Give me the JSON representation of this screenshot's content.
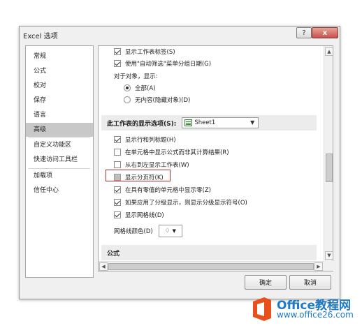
{
  "window": {
    "title": "Excel 选项",
    "help_label": "?",
    "close_label": "x"
  },
  "sidebar": {
    "items": [
      {
        "label": "常规"
      },
      {
        "label": "公式"
      },
      {
        "label": "校对"
      },
      {
        "label": "保存"
      },
      {
        "label": "语言"
      },
      {
        "label": "高级",
        "active": true
      },
      {
        "label": "自定义功能区"
      },
      {
        "label": "快速访问工具栏"
      },
      {
        "label": "加载项"
      },
      {
        "label": "信任中心"
      }
    ]
  },
  "options": {
    "show_sheet_tabs": {
      "label": "显示工作表标签(S)",
      "checked": true
    },
    "group_dates": {
      "label": "使用\"自动筛选\"菜单分组日期(G)",
      "checked": true
    },
    "objects_label": "对于对象，显示:",
    "radio_all": {
      "label": "全部(A)",
      "selected": true
    },
    "radio_none": {
      "label": "无内容(隐藏对象)(D)",
      "selected": false
    }
  },
  "sheet_section": {
    "title": "此工作表的显示选项(S):",
    "selected_sheet": "Sheet1",
    "items": [
      {
        "label": "显示行和列标题(H)",
        "checked": true
      },
      {
        "label": "在单元格中显示公式而非其计算结果(R)",
        "checked": false
      },
      {
        "label": "从右到左显示工作表(W)",
        "checked": false
      },
      {
        "label": "显示分页符(K)",
        "checked": false
      },
      {
        "label": "在具有零值的单元格中显示零(Z)",
        "checked": true
      },
      {
        "label": "如果应用了分级显示，则显示分级显示符号(O)",
        "checked": true
      },
      {
        "label": "显示网格线(D)",
        "checked": true
      }
    ],
    "gridline_color_label": "网格线颜色(D)"
  },
  "formula_section": {
    "title": "公式"
  },
  "buttons": {
    "ok": "确定",
    "cancel": "取消"
  },
  "watermark": {
    "title": "Office教程网",
    "url": "www.office26.com"
  },
  "colors": {
    "accent": "#1f78c8",
    "highlight": "#e02020",
    "active_nav": "#c8c8c8"
  }
}
